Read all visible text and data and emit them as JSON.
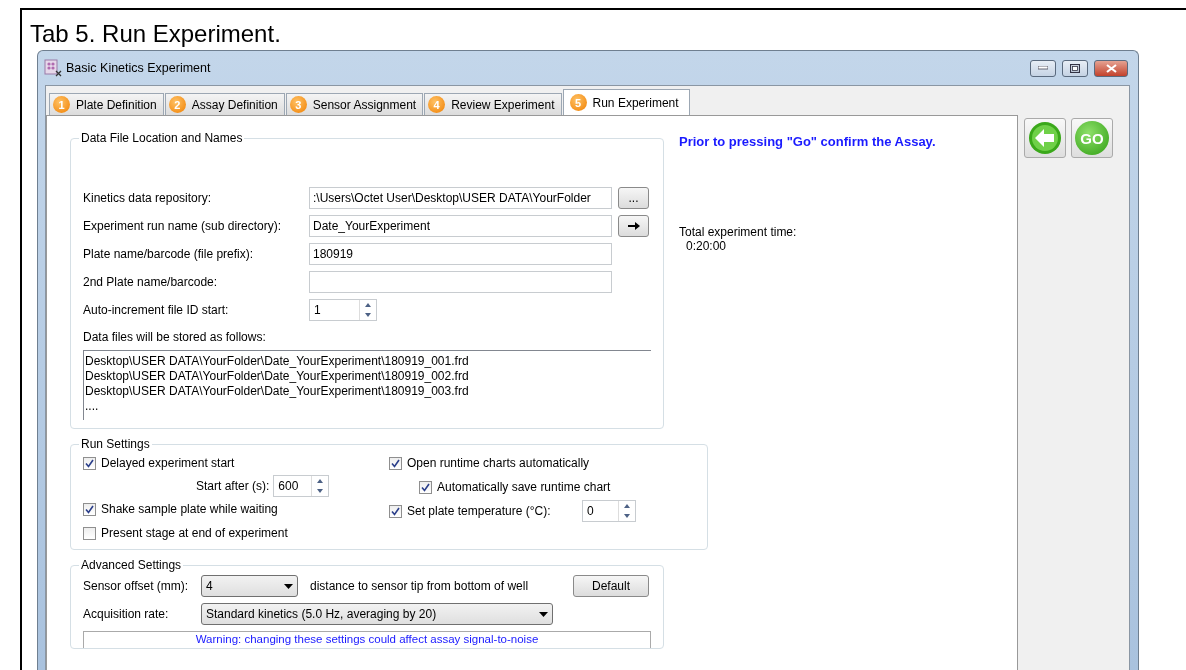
{
  "caption": "Tab 5.  Run Experiment.",
  "window": {
    "title": "Basic Kinetics Experiment"
  },
  "tabs": [
    {
      "number": "1",
      "label": "Plate Definition",
      "selected": false
    },
    {
      "number": "2",
      "label": "Assay Definition",
      "selected": false
    },
    {
      "number": "3",
      "label": "Sensor Assignment",
      "selected": false
    },
    {
      "number": "4",
      "label": "Review Experiment",
      "selected": false
    },
    {
      "number": "5",
      "label": "Run Experiment",
      "selected": true
    }
  ],
  "data_file_group": {
    "title": "Data File Location and Names",
    "fields": [
      {
        "kind": "browse",
        "label": "Kinetics data repository:",
        "value": ":\\Users\\Octet User\\Desktop\\USER DATA\\YourFolder",
        "button": "..."
      },
      {
        "kind": "arrow",
        "label": "Experiment run name (sub directory):",
        "value": "Date_YourExperiment"
      },
      {
        "kind": "text",
        "label": "Plate name/barcode (file prefix):",
        "value": "180919"
      },
      {
        "kind": "text",
        "label": "2nd Plate name/barcode:"
      },
      {
        "kind": "spinner",
        "label": "Auto-increment file ID start:",
        "value": "1"
      }
    ],
    "files_label": "Data files will be stored as follows:",
    "files": [
      "Desktop\\USER DATA\\YourFolder\\Date_YourExperiment\\180919_001.frd",
      "Desktop\\USER DATA\\YourFolder\\Date_YourExperiment\\180919_002.frd",
      "Desktop\\USER DATA\\YourFolder\\Date_YourExperiment\\180919_003.frd",
      "...."
    ]
  },
  "run_settings": {
    "title": "Run Settings",
    "left": [
      {
        "kind": "checkbox",
        "label": "Delayed experiment start",
        "checked": true
      },
      {
        "kind": "spinner",
        "label": "Start after (s):",
        "value": "600"
      },
      {
        "kind": "checkbox",
        "label": "Shake sample plate while waiting",
        "checked": true
      },
      {
        "kind": "checkbox",
        "label": "Present stage at end of experiment",
        "checked": false
      }
    ],
    "right": [
      {
        "kind": "checkbox",
        "label": "Open runtime charts automatically",
        "checked": true,
        "children": [
          {
            "kind": "checkbox",
            "label": "Automatically save runtime chart",
            "checked": true
          }
        ]
      },
      {
        "kind": "checkbox_spinner",
        "label": "Set plate temperature (°C):",
        "checked": true,
        "value": "0"
      }
    ]
  },
  "advanced_settings": {
    "title": "Advanced Settings",
    "sensor_offset": {
      "label": "Sensor offset (mm):",
      "value": "4",
      "note": "distance to sensor tip from bottom of well",
      "button": "Default"
    },
    "acquisition_rate": {
      "label": "Acquisition rate:",
      "value": "Standard kinetics (5.0 Hz, averaging by 20)"
    },
    "warning": "Warning: changing these settings could affect assay signal-to-noise"
  },
  "message": "Prior to pressing \"Go\" confirm the Assay.",
  "total_time": {
    "label": "Total experiment time:",
    "value": "0:20:00"
  },
  "go_button": {
    "label": "GO"
  }
}
